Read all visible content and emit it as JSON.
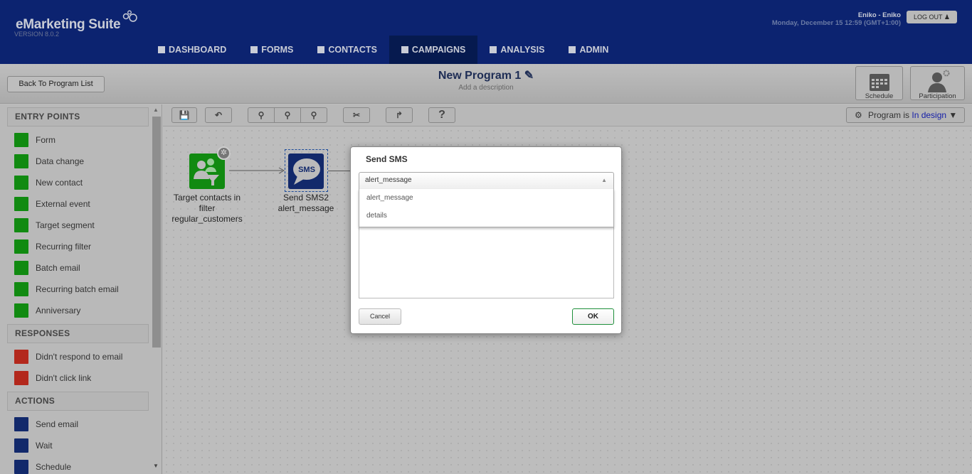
{
  "app": {
    "name": "eMarketing Suite",
    "version": "VERSION 8.0.2"
  },
  "user": {
    "name": "Eniko - Eniko",
    "datetime": "Monday, December 15 12:59 (GMT+1:00)",
    "logout": "LOG OUT"
  },
  "nav": [
    {
      "label": "DASHBOARD",
      "icon": "grid-icon"
    },
    {
      "label": "FORMS",
      "icon": "form-icon"
    },
    {
      "label": "CONTACTS",
      "icon": "list-icon"
    },
    {
      "label": "CAMPAIGNS",
      "icon": "document-icon",
      "active": true
    },
    {
      "label": "ANALYSIS",
      "icon": "bar-chart-icon"
    },
    {
      "label": "ADMIN",
      "icon": "gear-icon"
    }
  ],
  "program": {
    "back": "Back To Program List",
    "title": "New Program 1",
    "description": "Add a description",
    "schedule": "Schedule",
    "participation": "Participation",
    "status_prefix": "Program is",
    "status": "In design"
  },
  "colors": {
    "header": "#0c2370",
    "entry": "#118a11",
    "response": "#b3281c",
    "action": "#12296b"
  },
  "sidebar": {
    "entry_title": "ENTRY POINTS",
    "entry": [
      "Form",
      "Data change",
      "New contact",
      "External event",
      "Target segment",
      "Recurring filter",
      "Batch email",
      "Recurring batch email",
      "Anniversary"
    ],
    "responses_title": "RESPONSES",
    "responses": [
      "Didn't respond to email",
      "Didn't click link"
    ],
    "actions_title": "ACTIONS",
    "actions": [
      "Send email",
      "Wait",
      "Schedule"
    ]
  },
  "toolbar": {
    "help": "?"
  },
  "canvas": {
    "node1": {
      "label": "Target contacts in filter regular_customers"
    },
    "node2": {
      "label1": "Send SMS2",
      "label2": "alert_message",
      "icon_text": "SMS"
    }
  },
  "modal": {
    "title": "Send SMS",
    "selected": "alert_message",
    "options": [
      "alert_message",
      "details"
    ],
    "cancel": "Cancel",
    "ok": "OK"
  }
}
